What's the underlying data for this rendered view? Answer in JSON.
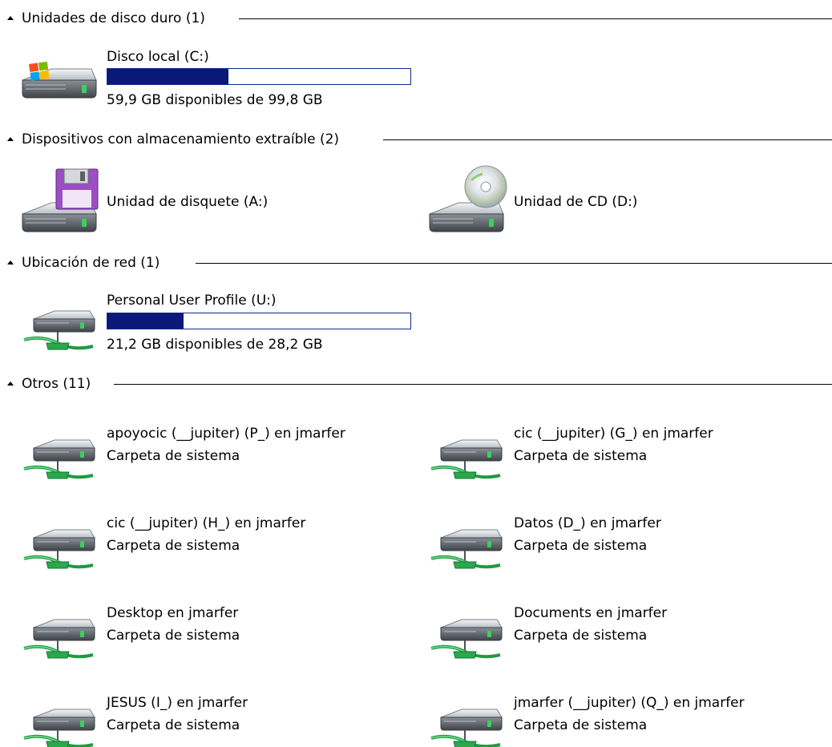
{
  "colors": {
    "bar_fill": "#0b1877",
    "bar_border": "#112a8f",
    "network_cable": "#2aa84a"
  },
  "groups": {
    "hard_disks": {
      "title": "Unidades de disco duro (1)",
      "items": [
        {
          "name": "Disco local (C:)",
          "usage_fraction": 0.4,
          "detail": "59,9 GB disponibles de 99,8 GB",
          "icon": "windows-hard-drive-icon"
        }
      ]
    },
    "removable": {
      "title": "Dispositivos con almacenamiento extraíble (2)",
      "items": [
        {
          "name": "Unidad de disquete (A:)",
          "icon": "floppy-drive-icon"
        },
        {
          "name": "Unidad de CD (D:)",
          "icon": "cd-drive-icon"
        }
      ]
    },
    "network": {
      "title": "Ubicación de red (1)",
      "items": [
        {
          "name": "Personal User Profile (U:)",
          "usage_fraction": 0.25,
          "detail": "21,2 GB disponibles de 28,2 GB",
          "icon": "network-drive-icon"
        }
      ]
    },
    "others": {
      "title": "Otros (11)",
      "items": [
        {
          "name": "apoyocic (__jupiter) (P_) en jmarfer",
          "subtitle": "Carpeta de sistema",
          "icon": "network-drive-icon"
        },
        {
          "name": "cic (__jupiter) (G_) en jmarfer",
          "subtitle": "Carpeta de sistema",
          "icon": "network-drive-icon"
        },
        {
          "name": "cic (__jupiter) (H_) en jmarfer",
          "subtitle": "Carpeta de sistema",
          "icon": "network-drive-icon"
        },
        {
          "name": "Datos (D_) en jmarfer",
          "subtitle": "Carpeta de sistema",
          "icon": "network-drive-icon"
        },
        {
          "name": "Desktop en jmarfer",
          "subtitle": "Carpeta de sistema",
          "icon": "network-drive-icon"
        },
        {
          "name": "Documents en jmarfer",
          "subtitle": "Carpeta de sistema",
          "icon": "network-drive-icon"
        },
        {
          "name": "JESUS (I_) en jmarfer",
          "subtitle": "Carpeta de sistema",
          "icon": "network-drive-icon"
        },
        {
          "name": "jmarfer (__jupiter) (Q_) en jmarfer",
          "subtitle": "Carpeta de sistema",
          "icon": "network-drive-icon"
        }
      ]
    }
  }
}
